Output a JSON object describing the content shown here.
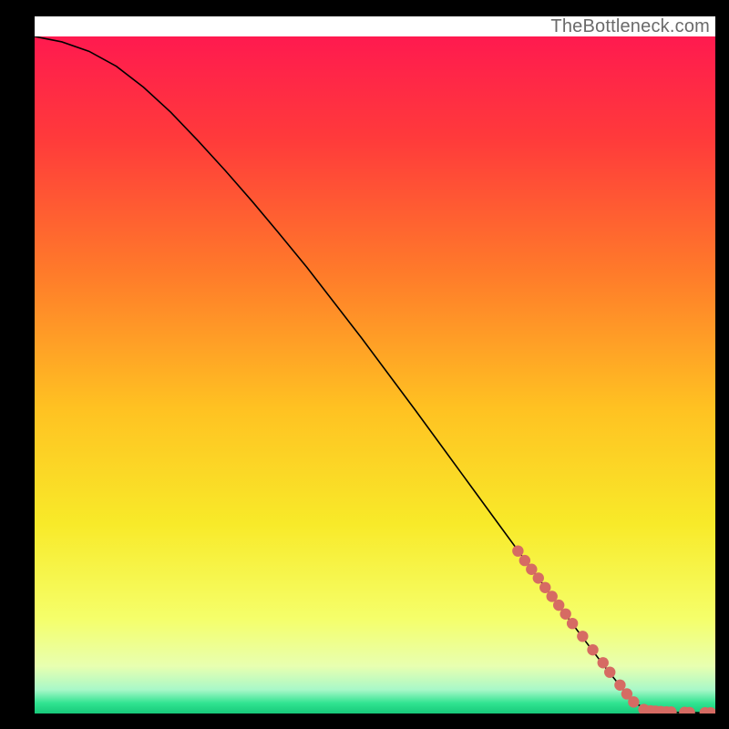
{
  "watermark": "TheBottleneck.com",
  "chart_data": {
    "type": "line",
    "title": "",
    "xlabel": "",
    "ylabel": "",
    "xlim": [
      0,
      100
    ],
    "ylim": [
      0,
      100
    ],
    "curve": {
      "x": [
        0,
        4,
        8,
        12,
        16,
        20,
        24,
        28,
        32,
        36,
        40,
        44,
        48,
        52,
        56,
        60,
        64,
        68,
        72,
        76,
        80,
        84,
        88,
        90.5,
        93,
        95,
        97,
        100
      ],
      "y": [
        100,
        99.2,
        97.8,
        95.6,
        92.5,
        88.8,
        84.6,
        80.2,
        75.6,
        70.8,
        65.9,
        60.7,
        55.5,
        50.1,
        44.7,
        39.2,
        33.7,
        28.2,
        22.7,
        17.3,
        11.9,
        6.6,
        1.6,
        0.4,
        0.2,
        0.15,
        0.12,
        0.1
      ]
    },
    "highlight_points": {
      "x": [
        71,
        72,
        73,
        74,
        75,
        76,
        77,
        78,
        79,
        80.5,
        82,
        83.5,
        84.5,
        86,
        87,
        88,
        89.5,
        90.5,
        91.2,
        92,
        92.8,
        93.5,
        95.5,
        96.2,
        98.5,
        99.3
      ],
      "y": [
        24,
        22.6,
        21.3,
        20,
        18.6,
        17.3,
        16,
        14.7,
        13.3,
        11.4,
        9.4,
        7.5,
        6.1,
        4.2,
        2.9,
        1.7,
        0.6,
        0.4,
        0.35,
        0.3,
        0.25,
        0.22,
        0.17,
        0.15,
        0.11,
        0.1
      ]
    },
    "gradient_stops": [
      {
        "offset": 0.0,
        "color": "#ff1a4f"
      },
      {
        "offset": 0.15,
        "color": "#ff3a3b"
      },
      {
        "offset": 0.35,
        "color": "#ff7b2a"
      },
      {
        "offset": 0.55,
        "color": "#ffc222"
      },
      {
        "offset": 0.72,
        "color": "#f8ea29"
      },
      {
        "offset": 0.86,
        "color": "#f5ff6a"
      },
      {
        "offset": 0.93,
        "color": "#e8ffb0"
      },
      {
        "offset": 0.965,
        "color": "#a8f8c8"
      },
      {
        "offset": 0.985,
        "color": "#2fe390"
      },
      {
        "offset": 1.0,
        "color": "#18c97a"
      }
    ],
    "point_color": "#d66b63",
    "line_color": "#000000"
  }
}
